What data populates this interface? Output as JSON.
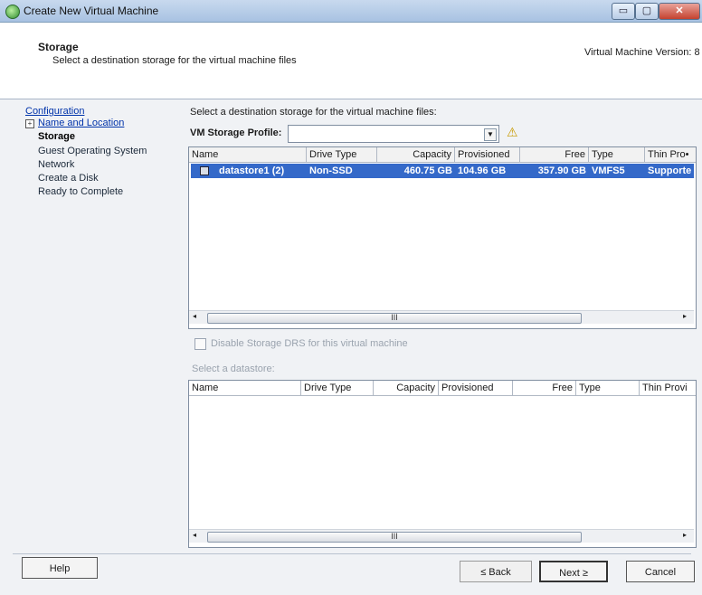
{
  "window": {
    "title": "Create New Virtual Machine",
    "min_glyph": "▭",
    "max_glyph": "▢",
    "close_glyph": "✕"
  },
  "header": {
    "title": "Storage",
    "subtitle": "Select a destination storage for the virtual machine files",
    "version": "Virtual Machine Version: 8"
  },
  "sidebar": {
    "expand_glyph": "+",
    "items": [
      {
        "label": "Configuration",
        "state": "link"
      },
      {
        "label": "Name and Location",
        "state": "link"
      },
      {
        "label": "Storage",
        "state": "current"
      },
      {
        "label": "Guest Operating System",
        "state": "plain"
      },
      {
        "label": "Network",
        "state": "plain"
      },
      {
        "label": "Create a Disk",
        "state": "plain"
      },
      {
        "label": "Ready to Complete",
        "state": "plain"
      }
    ]
  },
  "main": {
    "instruction": "Select a destination storage for the virtual machine files:",
    "profile_label": "VM Storage Profile:",
    "profile_value": "",
    "warning_icon": "warning-triangle-icon",
    "warning_glyph": "⚠",
    "combo_arrow_glyph": "▼",
    "top_table": {
      "columns": [
        "Name",
        "Drive Type",
        "Capacity",
        "Provisioned",
        "Free",
        "Type",
        "Thin Pro•"
      ],
      "rows": [
        {
          "name": "datastore1 (2)",
          "drive_type": "Non-SSD",
          "capacity": "460.75 GB",
          "provisioned": "104.96 GB",
          "free": "357.90 GB",
          "type": "VMFS5",
          "thin": "Supporte"
        }
      ]
    },
    "scroll_thumb_grip": "III",
    "scroll_left_glyph": "◂",
    "scroll_right_glyph": "▸",
    "disable_drs_label": "Disable Storage DRS for this virtual machine",
    "select_datastore_label": "Select a datastore:",
    "bottom_table": {
      "columns": [
        "Name",
        "Drive Type",
        "Capacity",
        "Provisioned",
        "Free",
        "Type",
        "Thin Provi"
      ]
    }
  },
  "footer": {
    "help": "Help",
    "back": "≤ Back",
    "next": "Next ≥",
    "cancel": "Cancel"
  }
}
